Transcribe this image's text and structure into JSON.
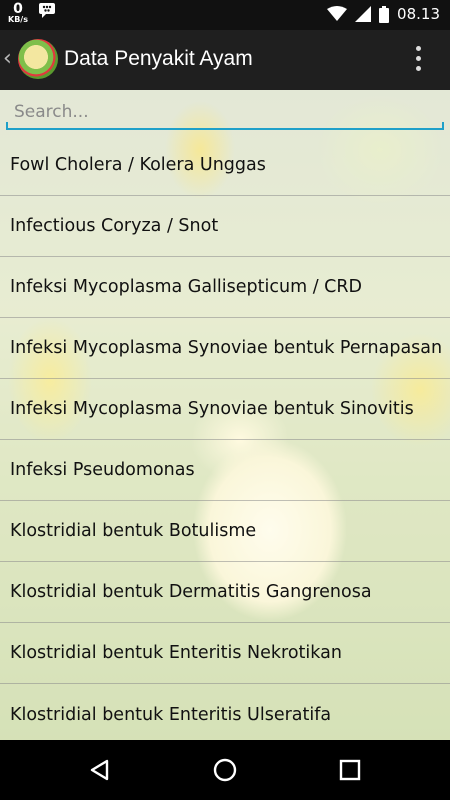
{
  "status_bar": {
    "speed_value": "0",
    "speed_unit": "KB/s",
    "time": "08.13",
    "icons": [
      "bbm-icon",
      "wifi-icon",
      "signal-icon",
      "battery-icon"
    ]
  },
  "app_bar": {
    "title": "Data Penyakit Ayam",
    "icons": [
      "back-chevron-icon",
      "app-logo-icon",
      "overflow-menu-icon"
    ]
  },
  "search": {
    "placeholder": "Search...",
    "value": ""
  },
  "items": [
    {
      "label": "Fowl Cholera / Kolera Unggas"
    },
    {
      "label": "Infectious Coryza / Snot"
    },
    {
      "label": "Infeksi Mycoplasma Gallisepticum / CRD"
    },
    {
      "label": "Infeksi Mycoplasma Synoviae bentuk Pernapasan"
    },
    {
      "label": "Infeksi Mycoplasma Synoviae bentuk Sinovitis"
    },
    {
      "label": "Infeksi Pseudomonas"
    },
    {
      "label": "Klostridial bentuk Botulisme"
    },
    {
      "label": "Klostridial bentuk Dermatitis Gangrenosa"
    },
    {
      "label": "Klostridial bentuk Enteritis Nekrotikan"
    },
    {
      "label": "Klostridial bentuk Enteritis Ulseratifa"
    }
  ],
  "nav_bar": {
    "icons": [
      "back-triangle-icon",
      "home-circle-icon",
      "recents-square-icon"
    ]
  },
  "colors": {
    "accent": "#1fa0c9",
    "app_bar": "#1f1f1f",
    "status_bar": "#111111"
  }
}
